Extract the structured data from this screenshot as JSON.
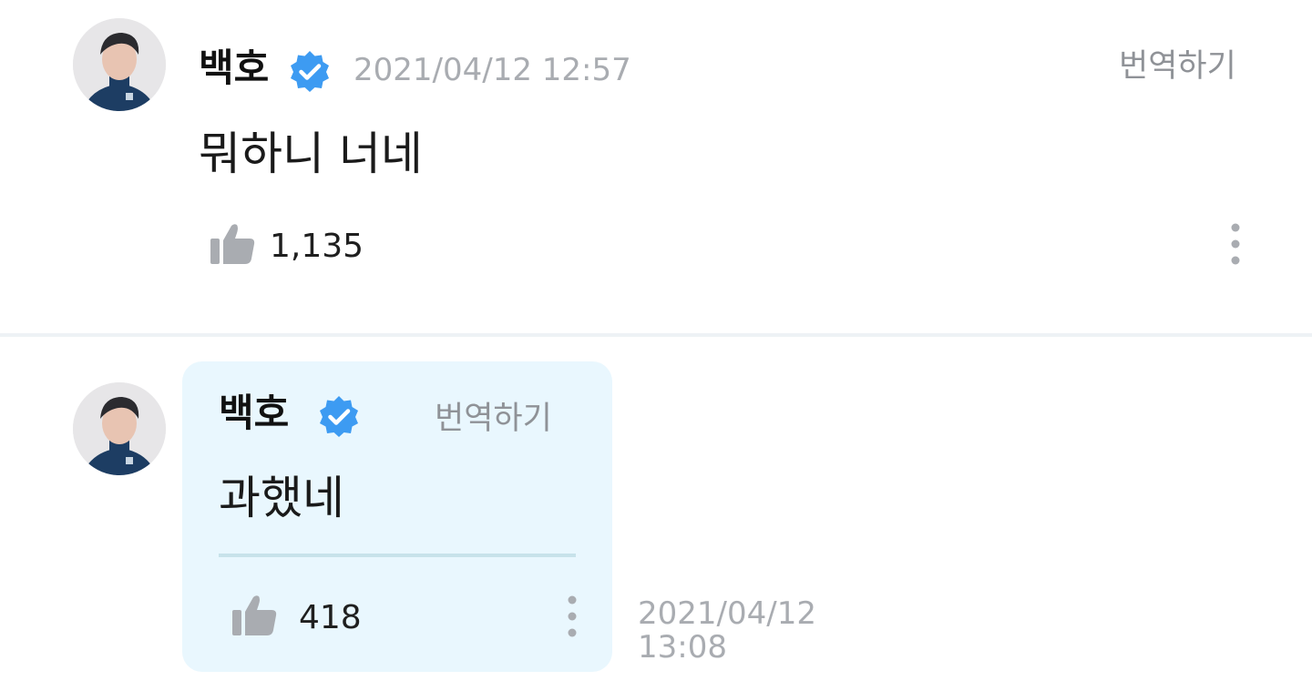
{
  "post": {
    "author": "백호",
    "timestamp": "2021/04/12 12:57",
    "translate_label": "번역하기",
    "text": "뭐하니 너네",
    "like_count": "1,135"
  },
  "reply": {
    "author": "백호",
    "translate_label": "번역하기",
    "text": "과했네",
    "like_count": "418",
    "timestamp_date": "2021/04/12",
    "timestamp_time": "13:08"
  },
  "colors": {
    "verified_badge": "#3d9bf2",
    "reply_bubble_bg": "#e9f7fe",
    "muted_text": "#a9acb1",
    "icon_gray": "#a9acb1"
  },
  "icons": {
    "verified": "verified-badge-icon",
    "like": "thumbs-up-icon",
    "more": "more-vertical-icon"
  }
}
